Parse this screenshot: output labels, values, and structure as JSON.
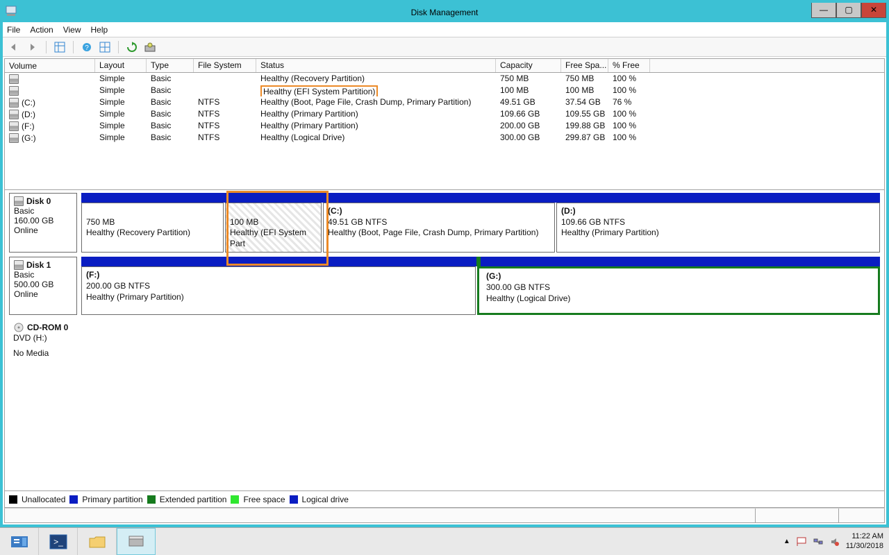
{
  "window": {
    "title": "Disk Management"
  },
  "menu": {
    "file": "File",
    "action": "Action",
    "view": "View",
    "help": "Help"
  },
  "columns": {
    "volume": "Volume",
    "layout": "Layout",
    "type": "Type",
    "fs": "File System",
    "status": "Status",
    "capacity": "Capacity",
    "free": "Free Spa...",
    "pct": "% Free"
  },
  "volumes": [
    {
      "name": "",
      "layout": "Simple",
      "type": "Basic",
      "fs": "",
      "status": "Healthy (Recovery Partition)",
      "capacity": "750 MB",
      "free": "750 MB",
      "pct": "100 %"
    },
    {
      "name": "",
      "layout": "Simple",
      "type": "Basic",
      "fs": "",
      "status": "Healthy (EFI System Partition)",
      "capacity": "100 MB",
      "free": "100 MB",
      "pct": "100 %",
      "annot": true
    },
    {
      "name": "(C:)",
      "layout": "Simple",
      "type": "Basic",
      "fs": "NTFS",
      "status": "Healthy (Boot, Page File, Crash Dump, Primary Partition)",
      "capacity": "49.51 GB",
      "free": "37.54 GB",
      "pct": "76 %"
    },
    {
      "name": "(D:)",
      "layout": "Simple",
      "type": "Basic",
      "fs": "NTFS",
      "status": "Healthy (Primary Partition)",
      "capacity": "109.66 GB",
      "free": "109.55 GB",
      "pct": "100 %"
    },
    {
      "name": "(F:)",
      "layout": "Simple",
      "type": "Basic",
      "fs": "NTFS",
      "status": "Healthy (Primary Partition)",
      "capacity": "200.00 GB",
      "free": "199.88 GB",
      "pct": "100 %"
    },
    {
      "name": "(G:)",
      "layout": "Simple",
      "type": "Basic",
      "fs": "NTFS",
      "status": "Healthy (Logical Drive)",
      "capacity": "300.00 GB",
      "free": "299.87 GB",
      "pct": "100 %"
    }
  ],
  "disks": {
    "disk0": {
      "title": "Disk 0",
      "type": "Basic",
      "size": "160.00 GB",
      "state": "Online",
      "p1": {
        "a": "750 MB",
        "b": "Healthy (Recovery Partition)"
      },
      "p2": {
        "a": "100 MB",
        "b": "Healthy (EFI System Part"
      },
      "p3": {
        "t": "(C:)",
        "a": "49.51 GB NTFS",
        "b": "Healthy (Boot, Page File, Crash Dump, Primary Partition)"
      },
      "p4": {
        "t": "(D:)",
        "a": "109.66 GB NTFS",
        "b": "Healthy (Primary Partition)"
      }
    },
    "disk1": {
      "title": "Disk 1",
      "type": "Basic",
      "size": "500.00 GB",
      "state": "Online",
      "p1": {
        "t": "(F:)",
        "a": "200.00 GB NTFS",
        "b": "Healthy (Primary Partition)"
      },
      "p2": {
        "t": "(G:)",
        "a": "300.00 GB NTFS",
        "b": "Healthy (Logical Drive)"
      }
    },
    "cdrom": {
      "title": "CD-ROM 0",
      "drive": "DVD (H:)",
      "state": "No Media"
    }
  },
  "legend": {
    "unalloc": "Unallocated",
    "primary": "Primary partition",
    "extended": "Extended partition",
    "free": "Free space",
    "logical": "Logical drive"
  },
  "buttons": {
    "min": "—",
    "max": "▢",
    "close": "✕"
  },
  "clock": {
    "time": "11:22 AM",
    "date": "11/30/2018"
  }
}
